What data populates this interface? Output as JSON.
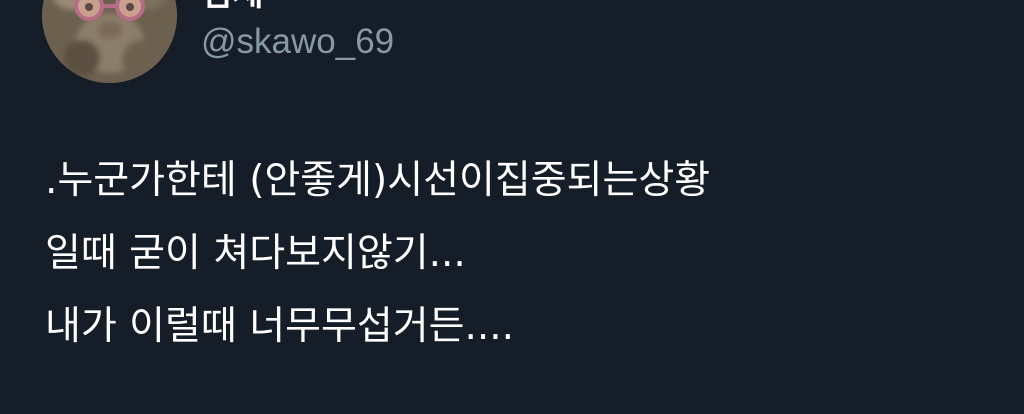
{
  "theme": {
    "background": "#151d29",
    "text": "#ffffff",
    "secondary_text": "#8899a6"
  },
  "tweet": {
    "author": {
      "display_name": "김세",
      "handle": "@skawo_69",
      "avatar": "profile-photo"
    },
    "text_lines": [
      ".누군가한테 (안좋게)시선이집중되는상황",
      "일때 굳이 쳐다보지않기...",
      "내가 이럴때 너무무섭거든...."
    ]
  }
}
